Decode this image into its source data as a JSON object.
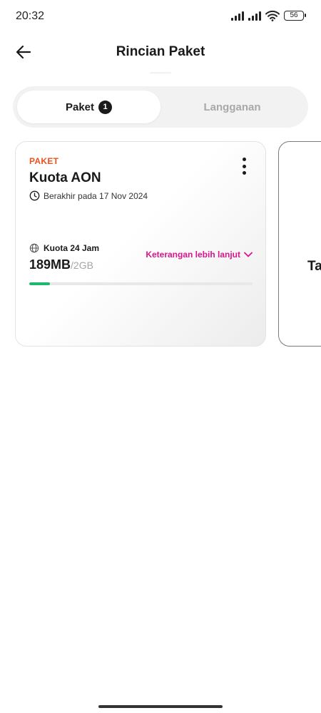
{
  "status_bar": {
    "time": "20:32",
    "battery": "56",
    "icons": [
      "signal-icon",
      "signal-icon",
      "wifi-icon",
      "battery-icon"
    ]
  },
  "header": {
    "title": "Rincian Paket",
    "back_icon": "arrow-left-icon"
  },
  "tabs": [
    {
      "label": "Paket",
      "badge": "1",
      "active": true
    },
    {
      "label": "Langganan",
      "active": false
    }
  ],
  "package_card": {
    "category": "PAKET",
    "title": "Kuota AON",
    "expiry": "Berakhir pada 17 Nov 2024",
    "quota_label": "Kuota 24 Jam",
    "quota_used": "189MB",
    "quota_total": "/2GB",
    "detail_link": "Keterangan lebih lanjut",
    "progress_fraction": 0.092,
    "colors": {
      "category": "#e8531e",
      "link": "#d6168c",
      "progress": "#1db86b"
    }
  },
  "next_card": {
    "label_partial": "Ta"
  }
}
